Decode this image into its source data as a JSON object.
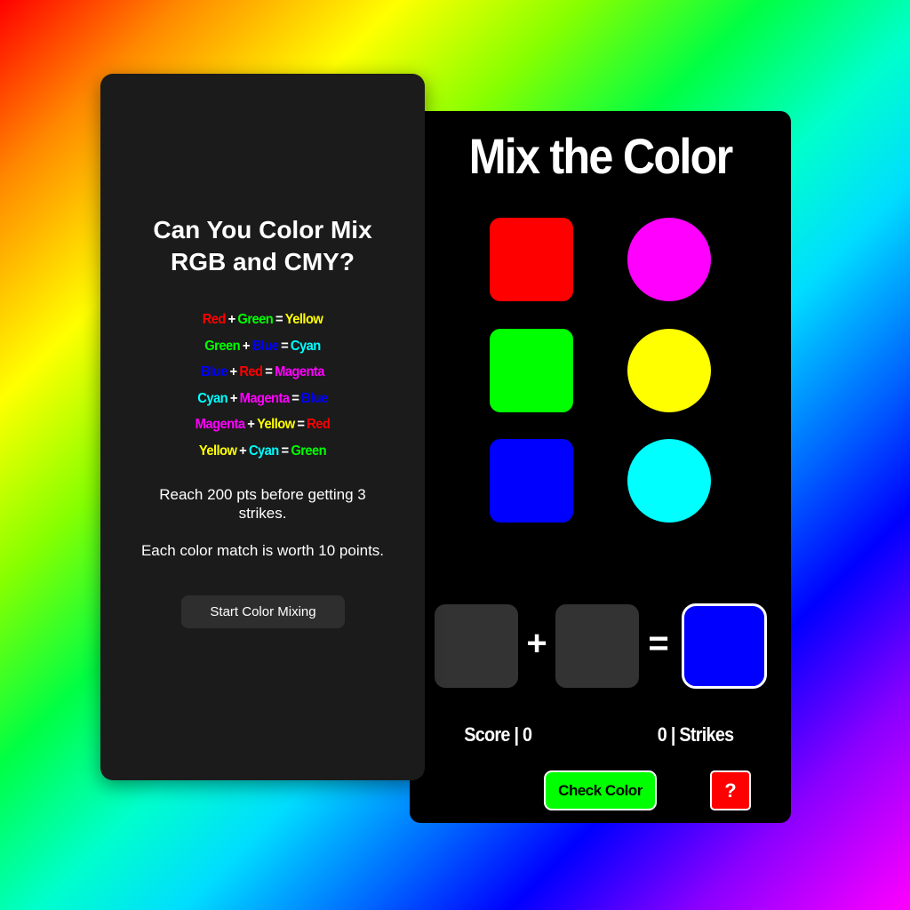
{
  "colors": {
    "red": "#ff0000",
    "green": "#00ff00",
    "blue": "#0000ff",
    "cyan": "#00ffff",
    "magenta": "#ff00ff",
    "yellow": "#ffff00",
    "panel_dark": "#1b1b1b",
    "slot_gray": "#333333"
  },
  "intro": {
    "title": "Can You Color Mix RGB and CMY?",
    "rules": [
      {
        "a": "Red",
        "b": "Green",
        "result": "Yellow"
      },
      {
        "a": "Green",
        "b": "Blue",
        "result": "Cyan"
      },
      {
        "a": "Blue",
        "b": "Red",
        "result": "Magenta"
      },
      {
        "a": "Cyan",
        "b": "Magenta",
        "result": "Blue"
      },
      {
        "a": "Magenta",
        "b": "Yellow",
        "result": "Red"
      },
      {
        "a": "Yellow",
        "b": "Cyan",
        "result": "Green"
      }
    ],
    "plus": "+",
    "equals": "=",
    "goal_text": "Reach 200 pts before getting 3 strikes.",
    "points_text": "Each color match is worth 10 points.",
    "start_label": "Start Color Mixing"
  },
  "game": {
    "title": "Mix the Color",
    "swatches": [
      {
        "name": "red",
        "shape": "square"
      },
      {
        "name": "green",
        "shape": "square"
      },
      {
        "name": "blue",
        "shape": "square"
      },
      {
        "name": "magenta",
        "shape": "circle"
      },
      {
        "name": "yellow",
        "shape": "circle"
      },
      {
        "name": "cyan",
        "shape": "circle"
      }
    ],
    "plus": "+",
    "equals": "=",
    "target_color": "blue",
    "score_label": "Score | 0",
    "strikes_label": "0 | Strikes",
    "score": 0,
    "strikes": 0,
    "check_label": "Check Color",
    "check_color": "#00ff00",
    "help_label": "?",
    "help_color": "#ff0000"
  }
}
